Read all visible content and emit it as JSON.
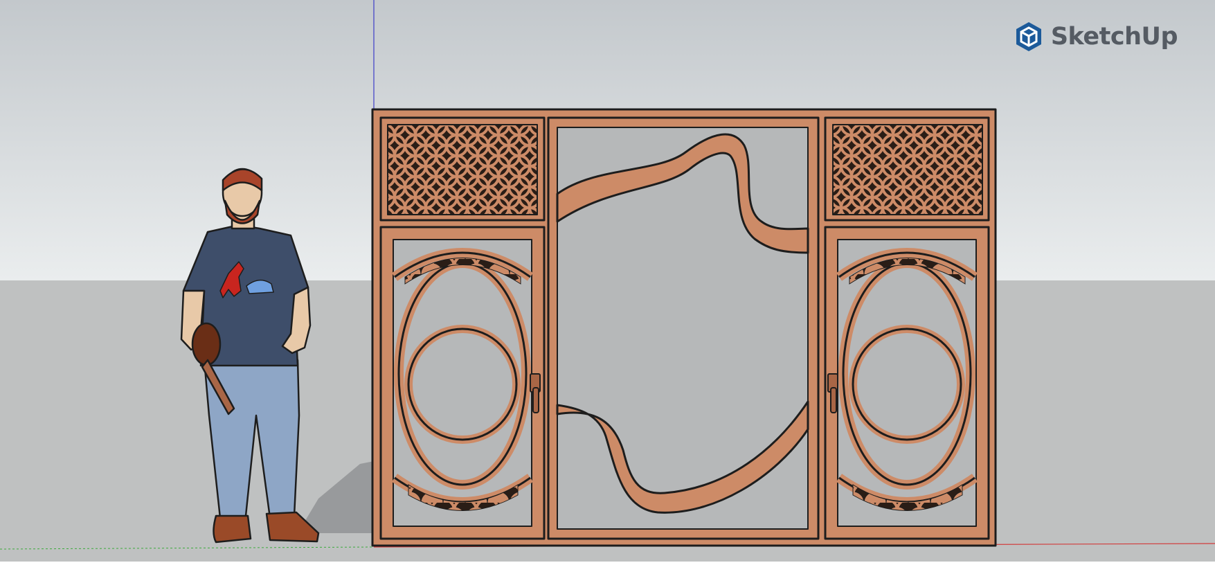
{
  "app": {
    "brand": "SketchUp",
    "brand_color": "#1c5a9a",
    "brand_text_color": "#555b63",
    "logo_icon": "sketchup-logo-icon"
  },
  "scene": {
    "sky_top_color": "#c3c8cc",
    "sky_bottom_color": "#eaedee",
    "ground_color": "#bfc1c1",
    "wood_color": "#cd8b67",
    "wood_dark_color": "#a96646",
    "outline_color": "#1d1d1d",
    "glass_color": "#b6b8b9",
    "axis_blue": "#3c3cc8",
    "axis_red": "#d23a3a",
    "axis_green": "#3caa3c"
  },
  "model": {
    "object": "double-door-screen-panel",
    "figure": "scale-figure-person",
    "shirt_color": "#3e4e6a",
    "jeans_color": "#8ea6c6",
    "hair_color": "#a8442a"
  }
}
